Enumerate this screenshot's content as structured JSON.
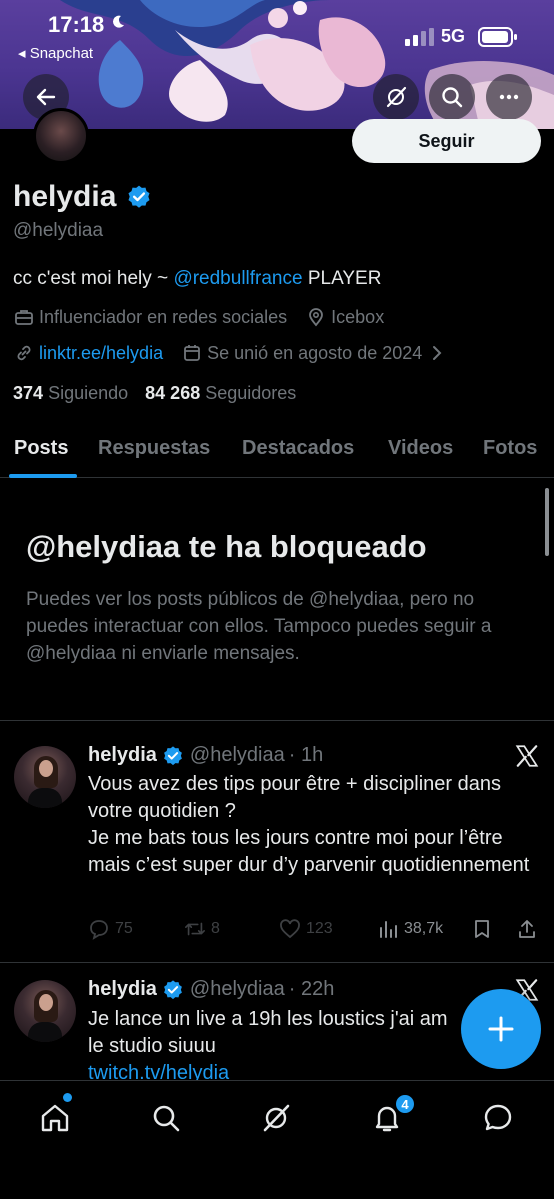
{
  "status_bar": {
    "time": "17:18",
    "back_app": "◂ Snapchat",
    "network": "5G"
  },
  "header": {
    "follow_label": "Seguir"
  },
  "profile": {
    "display_name": "helydia",
    "handle": "@helydiaa",
    "bio_prefix": "cc c'est moi hely ~ ",
    "bio_mention": "@redbullfrance",
    "bio_suffix": " PLAYER",
    "category": "Influenciador en redes sociales",
    "location": "Icebox",
    "website": "linktr.ee/helydia",
    "joined": "Se unió en agosto de 2024",
    "following_count": "374",
    "following_label": "Siguiendo",
    "followers_count": "84 268",
    "followers_label": "Seguidores"
  },
  "tabs": [
    "Posts",
    "Respuestas",
    "Destacados",
    "Videos",
    "Fotos"
  ],
  "blocked": {
    "title": "@helydiaa te ha bloqueado",
    "message": "Puedes ver los posts públicos de @helydiaa, pero no puedes interactuar con ellos. Tampoco puedes seguir a @helydiaa ni enviarle mensajes."
  },
  "posts": [
    {
      "name": "helydia",
      "handle": "@helydiaa",
      "time": "· 1h",
      "lines": [
        "Vous avez des tips pour être + discipliner dans votre quotidien ?",
        "Je me bats tous les jours contre moi pour l’être mais c’est super dur d’y parvenir quotidiennement"
      ],
      "replies": "75",
      "reposts": "8",
      "likes": "123",
      "views": "38,7k"
    },
    {
      "name": "helydia",
      "handle": "@helydiaa",
      "time": "· 22h",
      "text": "Je lance un live a 19h les loustics j'ai am",
      "text2": "le studio siuuu",
      "link": "twitch.tv/helydia"
    }
  ],
  "bottom_nav": {
    "notifications_badge": "4"
  },
  "colors": {
    "accent": "#1d9bf0",
    "background": "#000000",
    "muted": "#71767b"
  }
}
